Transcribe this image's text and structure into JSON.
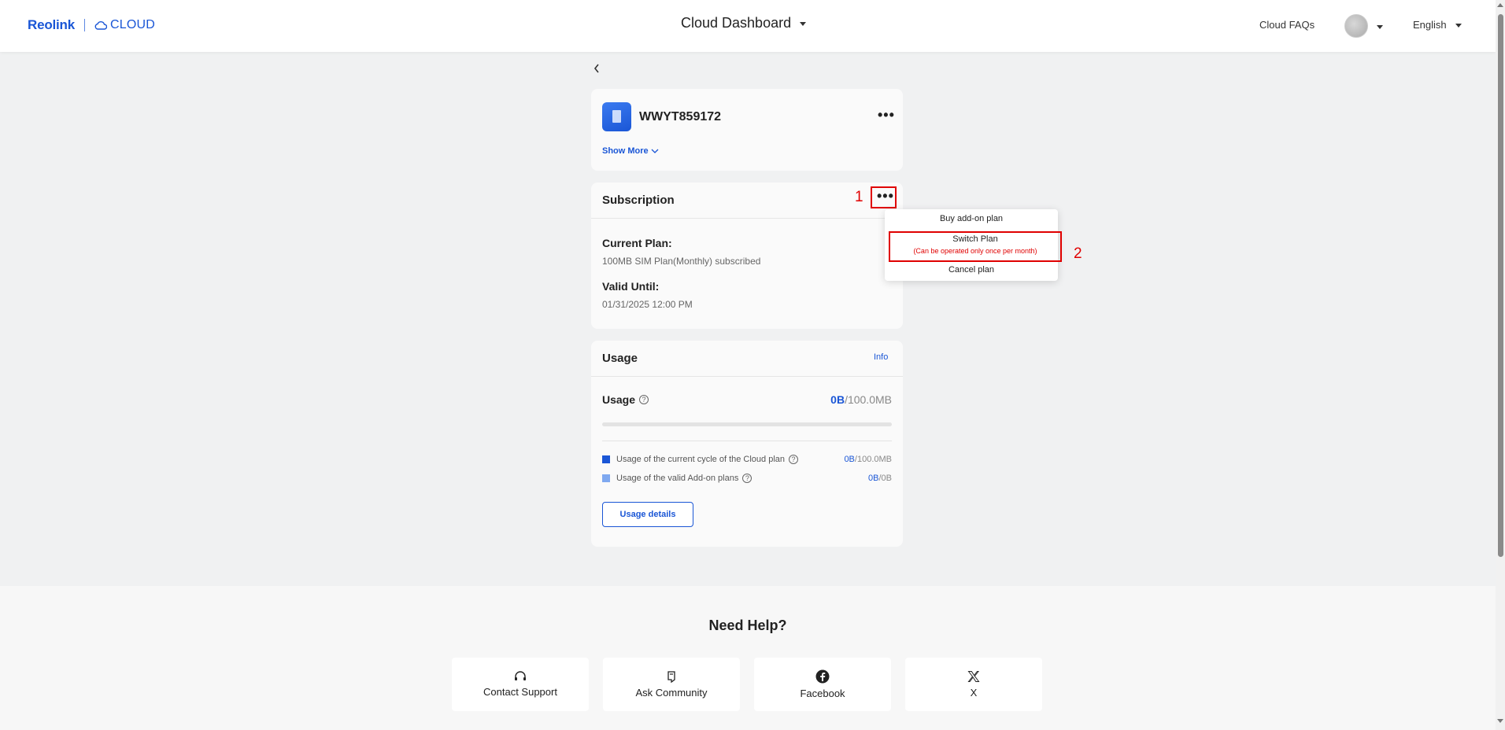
{
  "header": {
    "brand": "Reolink",
    "cloud_label": "CLOUD",
    "title": "Cloud Dashboard",
    "faq": "Cloud FAQs",
    "language": "English"
  },
  "device": {
    "name": "WWYT859172",
    "show_more": "Show More",
    "more_icon": "ellipsis-icon"
  },
  "subscription": {
    "title": "Subscription",
    "current_plan_label": "Current Plan:",
    "current_plan_value": "100MB SIM Plan(Monthly) subscribed",
    "valid_until_label": "Valid Until:",
    "valid_until_value": "01/31/2025 12:00 PM"
  },
  "annotations": {
    "marker_1": "1",
    "marker_2": "2",
    "color": "#e00000"
  },
  "dropdown": {
    "items": [
      {
        "label": "Buy add-on plan"
      },
      {
        "label": "Switch Plan",
        "note": "(Can be operated only once per month)"
      },
      {
        "label": "Cancel plan"
      }
    ]
  },
  "usage": {
    "title": "Usage",
    "info_link": "Info",
    "usage_label": "Usage",
    "used": "0B",
    "total": "/100.0MB",
    "progress_fraction": 0,
    "legend": [
      {
        "label": "Usage of the current cycle of the Cloud plan",
        "used": "0B",
        "total": "/100.0MB",
        "color": "#1a56d6"
      },
      {
        "label": "Usage of the valid Add-on plans",
        "used": "0B",
        "total": "/0B",
        "color": "#7fa9f0"
      }
    ],
    "details_button": "Usage details"
  },
  "footer": {
    "title": "Need Help?",
    "cards": [
      {
        "label": "Contact Support",
        "icon": "headset-icon"
      },
      {
        "label": "Ask Community",
        "icon": "community-icon"
      },
      {
        "label": "Facebook",
        "icon": "facebook-icon"
      },
      {
        "label": "X",
        "icon": "x-logo-icon"
      }
    ]
  },
  "colors": {
    "brand": "#1a56d6",
    "background": "#f0f1f2",
    "card": "#fafafa"
  }
}
